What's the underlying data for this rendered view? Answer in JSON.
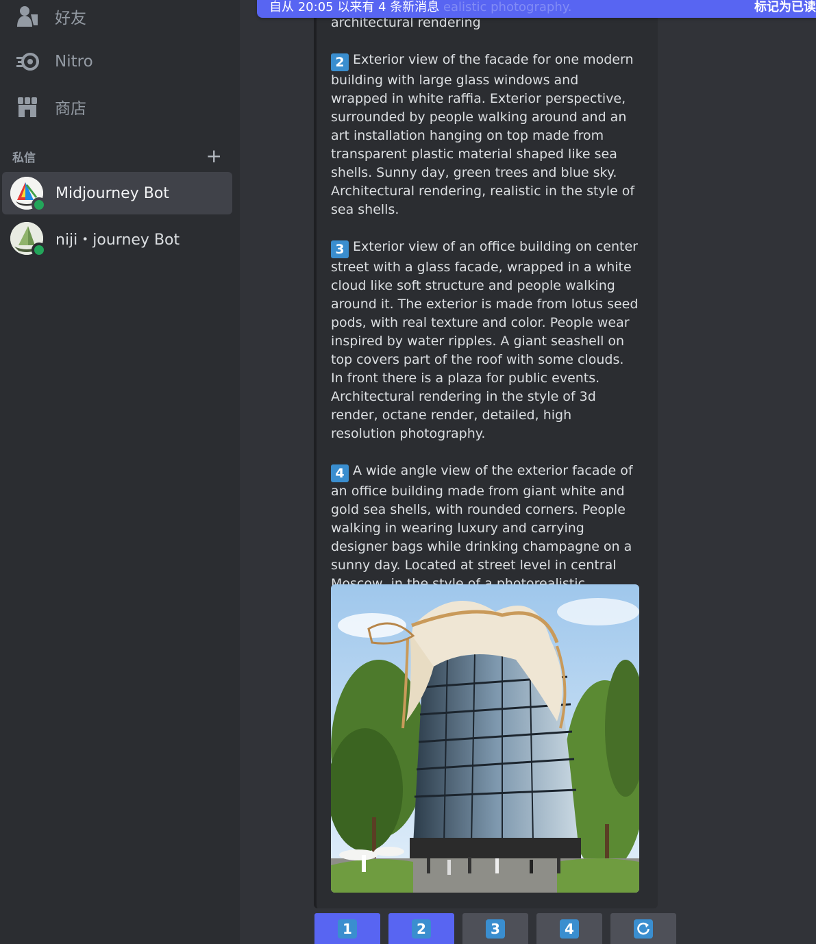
{
  "sidebar": {
    "nav": [
      {
        "label": "好友",
        "icon": "friends-icon"
      },
      {
        "label": "Nitro",
        "icon": "nitro-icon"
      },
      {
        "label": "商店",
        "icon": "shop-icon"
      }
    ],
    "dm_header": "私信",
    "dm_add": "+",
    "dms": [
      {
        "name": "Midjourney Bot",
        "status": "online",
        "active": true
      },
      {
        "name": "niji・journey Bot",
        "status": "online",
        "active": false
      }
    ]
  },
  "banner": {
    "text": "自从 20:05 以来有 4 条新消息",
    "faded_text": "ealistic photography.",
    "action": "标记为已读"
  },
  "embed": {
    "top_line": "architectural rendering",
    "prompts": [
      {
        "num": "2",
        "text": "Exterior view of the facade for one modern building with large glass windows and wrapped in white raffia. Exterior perspective, surrounded by people walking around and an art installation hanging on top made from transparent plastic material shaped like sea shells. Sunny day, green trees and blue sky. Architectural rendering, realistic in the style of sea shells."
      },
      {
        "num": "3",
        "text": "Exterior view of an office building on center street with a glass facade, wrapped in a white cloud like soft structure and people walking around it. The exterior is made from lotus seed pods, with real texture and color. People wear inspired by water ripples. A giant seashell on top covers part of the roof with some clouds. In front there is a plaza for public events. Architectural rendering in the style of 3d render, octane render, detailed, high resolution photography."
      },
      {
        "num": "4",
        "text": "A wide angle view of the exterior facade of an office building made from giant white and gold sea shells, with rounded corners. People walking in wearing luxury and carrying designer bags while drinking champagne on a sunny day. Located at street level in central Moscow, in the style of a photorealistic architectural render with a hyper realistic style."
      }
    ]
  },
  "buttons": [
    {
      "label": "1",
      "style": "primary"
    },
    {
      "label": "2",
      "style": "primary"
    },
    {
      "label": "3",
      "style": "secondary"
    },
    {
      "label": "4",
      "style": "secondary"
    },
    {
      "label": "",
      "icon": "refresh-icon",
      "style": "secondary"
    }
  ],
  "colors": {
    "accent": "#5865f2",
    "keycap": "#3a8ecf",
    "online": "#23a55a"
  }
}
